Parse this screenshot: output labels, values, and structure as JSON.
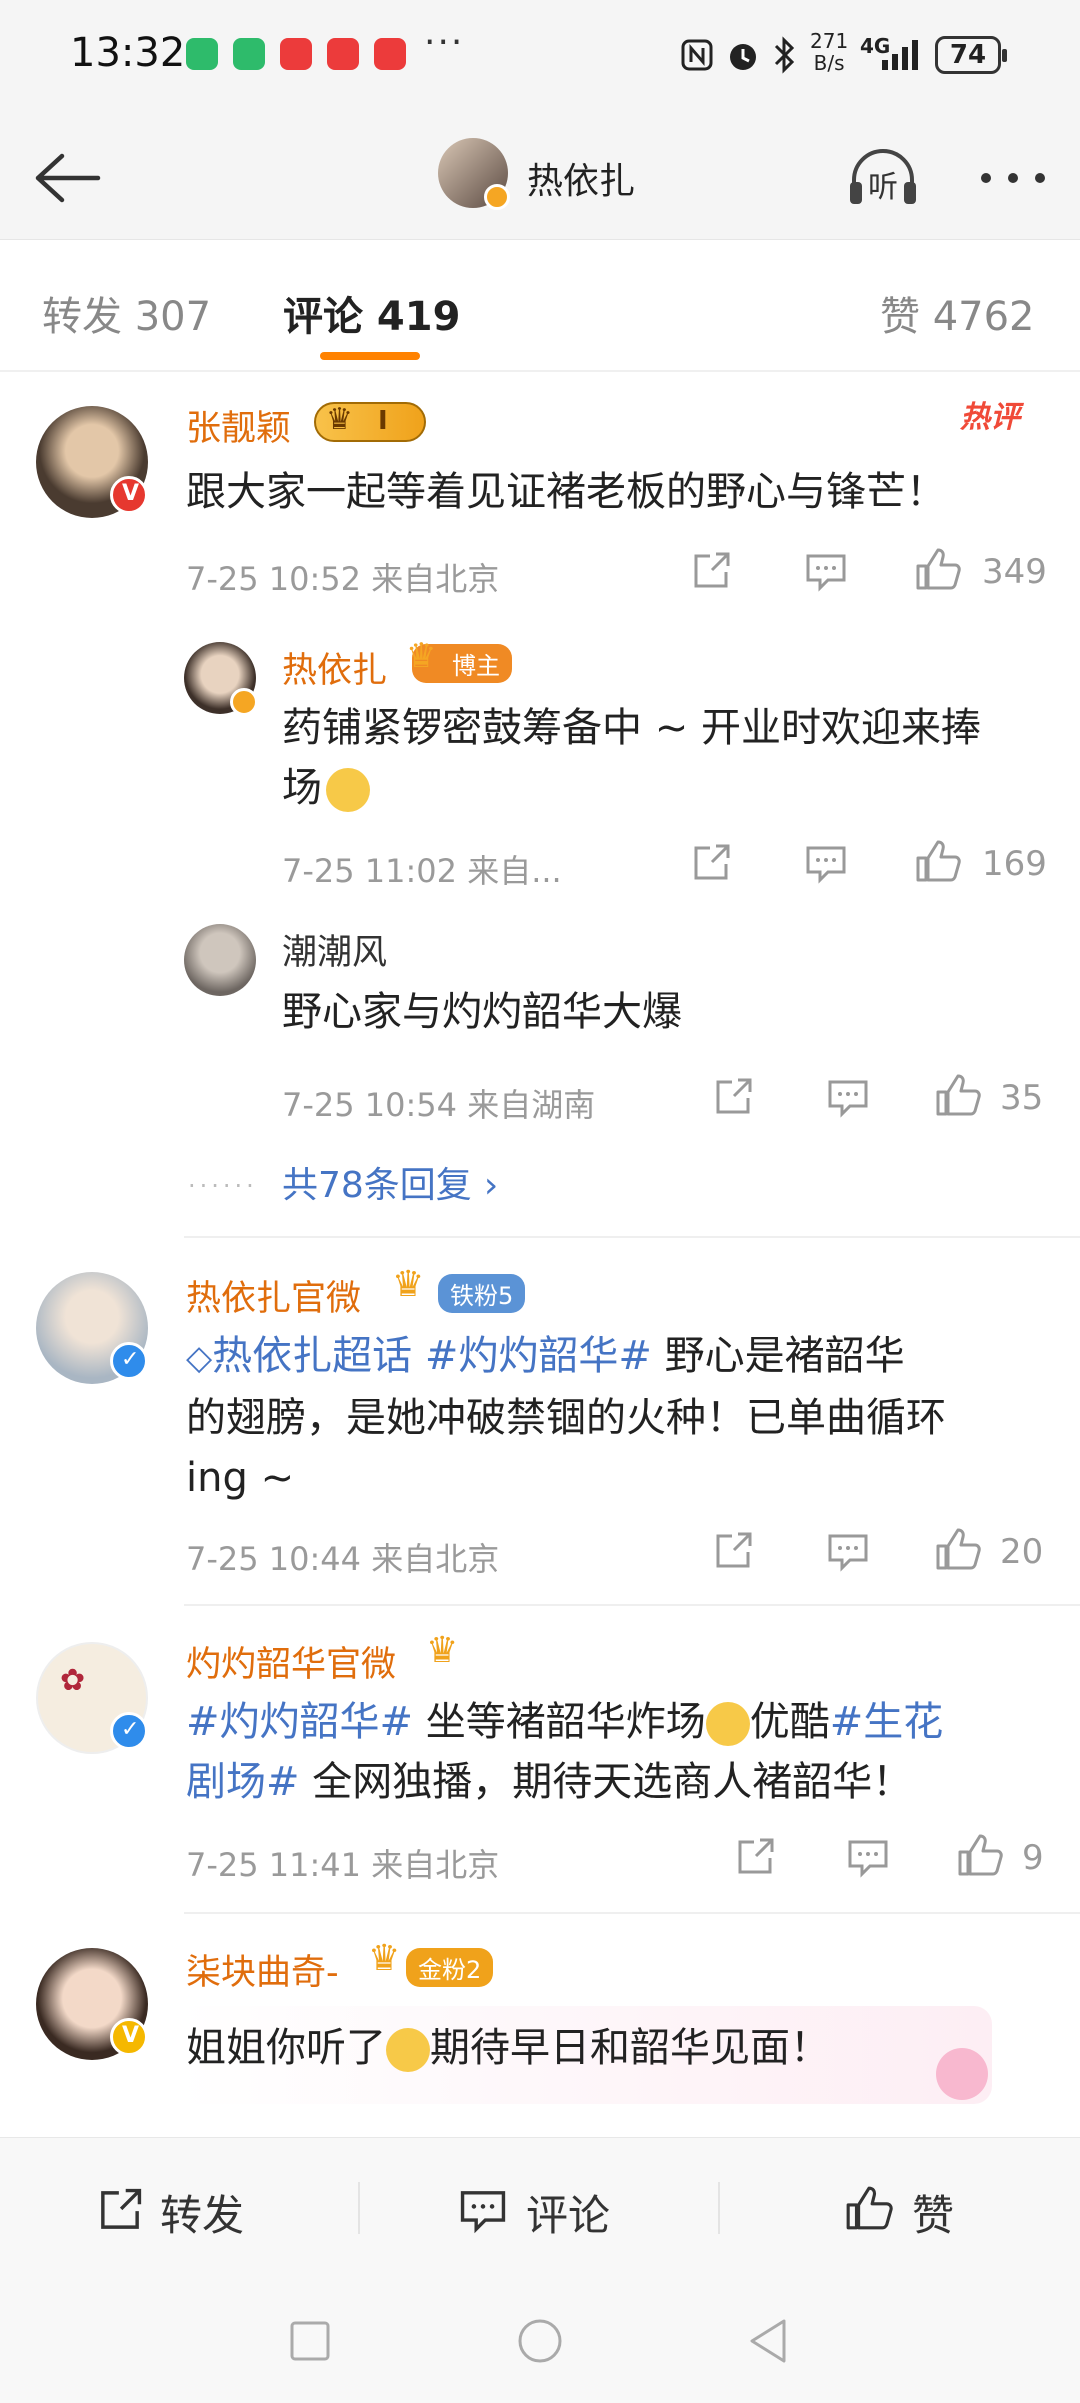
{
  "status_bar": {
    "time": "13:32",
    "dots": "···",
    "speed_top": "271",
    "speed_bottom": "B/s",
    "network": "4G",
    "battery": "74"
  },
  "header": {
    "title": "热依扎",
    "listen_label": "听"
  },
  "tabs": [
    {
      "label": "转发 307"
    },
    {
      "label": "评论 419"
    },
    {
      "label": "赞 4762"
    }
  ],
  "comments": [
    {
      "name": "张靓颖",
      "level": "I",
      "hot_label": "热评",
      "text": "跟大家一起等着见证褚老板的野心与锋芒！",
      "meta": "7-25 10:52 来自北京",
      "likes": "349",
      "replies": [
        {
          "name": "热依扎",
          "badge": "博主",
          "text_line1": "药铺紧锣密鼓筹备中 ~ 开业时欢迎来捧",
          "text_line2": "场",
          "meta": "7-25 11:02 来自...",
          "likes": "169"
        },
        {
          "name": "潮潮风",
          "text": "野心家与灼灼韶华大爆",
          "meta": "7-25 10:54 来自湖南",
          "likes": "35"
        }
      ],
      "more_replies": "共78条回复"
    },
    {
      "name": "热依扎官微",
      "badge": "铁粉5",
      "topic1": "热依扎超话",
      "topic2": "#灼灼韶华#",
      "text_a": " 野心是褚韶华",
      "text_line2": "的翅膀，是她冲破禁锢的火种！已单曲循环",
      "text_line3": "ing ~",
      "meta": "7-25 10:44 来自北京",
      "likes": "20"
    },
    {
      "name": "灼灼韶华官微",
      "topic1": "#灼灼韶华#",
      "text_a": " 坐等褚韶华炸场",
      "text_b": "优酷",
      "topic2": "#生花",
      "topic2b": "剧场#",
      "text_line2": " 全网独播，期待天选商人褚韶华！",
      "meta": "7-25 11:41 来自北京",
      "likes": "9"
    },
    {
      "name": "柒块曲奇-",
      "badge": "金粉2",
      "text_a": "姐姐你听了",
      "text_b": "期待早日和韶华见面！"
    }
  ],
  "bottom_bar": {
    "repost": "转发",
    "comment": "评论",
    "like": "赞"
  },
  "colors": {
    "accent": "#ff8200",
    "name_orange": "#e06d0c",
    "link_blue": "#4574c4",
    "vip_red": "#e6382f",
    "verified_blue": "#2f8ceb",
    "verified_gold": "#f5b800"
  }
}
